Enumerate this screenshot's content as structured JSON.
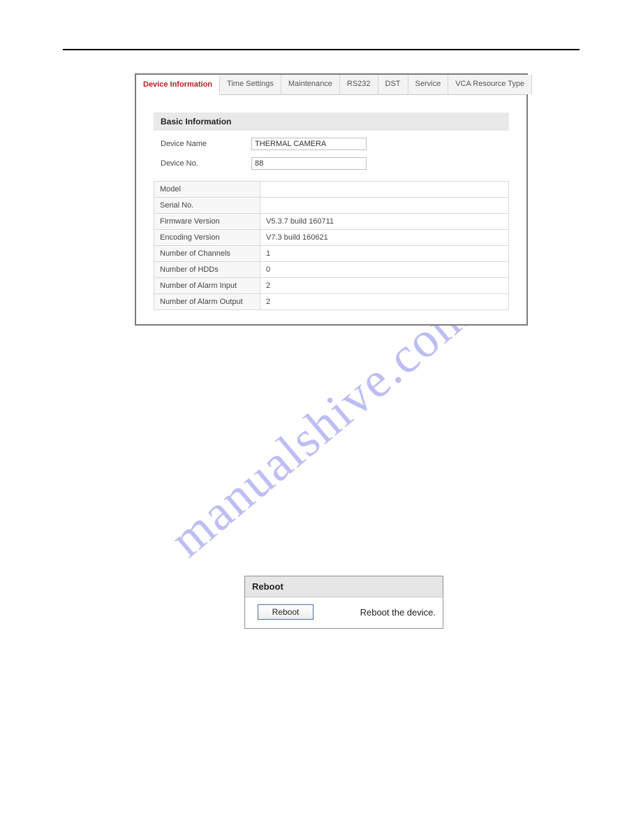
{
  "watermark": "manualshive.com",
  "tabs": [
    {
      "label": "Device Information",
      "active": true
    },
    {
      "label": "Time Settings",
      "active": false
    },
    {
      "label": "Maintenance",
      "active": false
    },
    {
      "label": "RS232",
      "active": false
    },
    {
      "label": "DST",
      "active": false
    },
    {
      "label": "Service",
      "active": false
    },
    {
      "label": "VCA Resource Type",
      "active": false
    }
  ],
  "basic_info": {
    "section_title": "Basic Information",
    "device_name_label": "Device Name",
    "device_name_value": "THERMAL CAMERA",
    "device_no_label": "Device No.",
    "device_no_value": "88",
    "rows": [
      {
        "key": "Model",
        "value": ""
      },
      {
        "key": "Serial No.",
        "value": ""
      },
      {
        "key": "Firmware Version",
        "value": "V5.3.7 build 160711"
      },
      {
        "key": "Encoding Version",
        "value": "V7.3 build 160621"
      },
      {
        "key": "Number of Channels",
        "value": "1"
      },
      {
        "key": "Number of HDDs",
        "value": "0"
      },
      {
        "key": "Number of Alarm Input",
        "value": "2"
      },
      {
        "key": "Number of Alarm Output",
        "value": "2"
      }
    ]
  },
  "reboot_panel": {
    "header": "Reboot",
    "button_label": "Reboot",
    "description": "Reboot the device."
  }
}
